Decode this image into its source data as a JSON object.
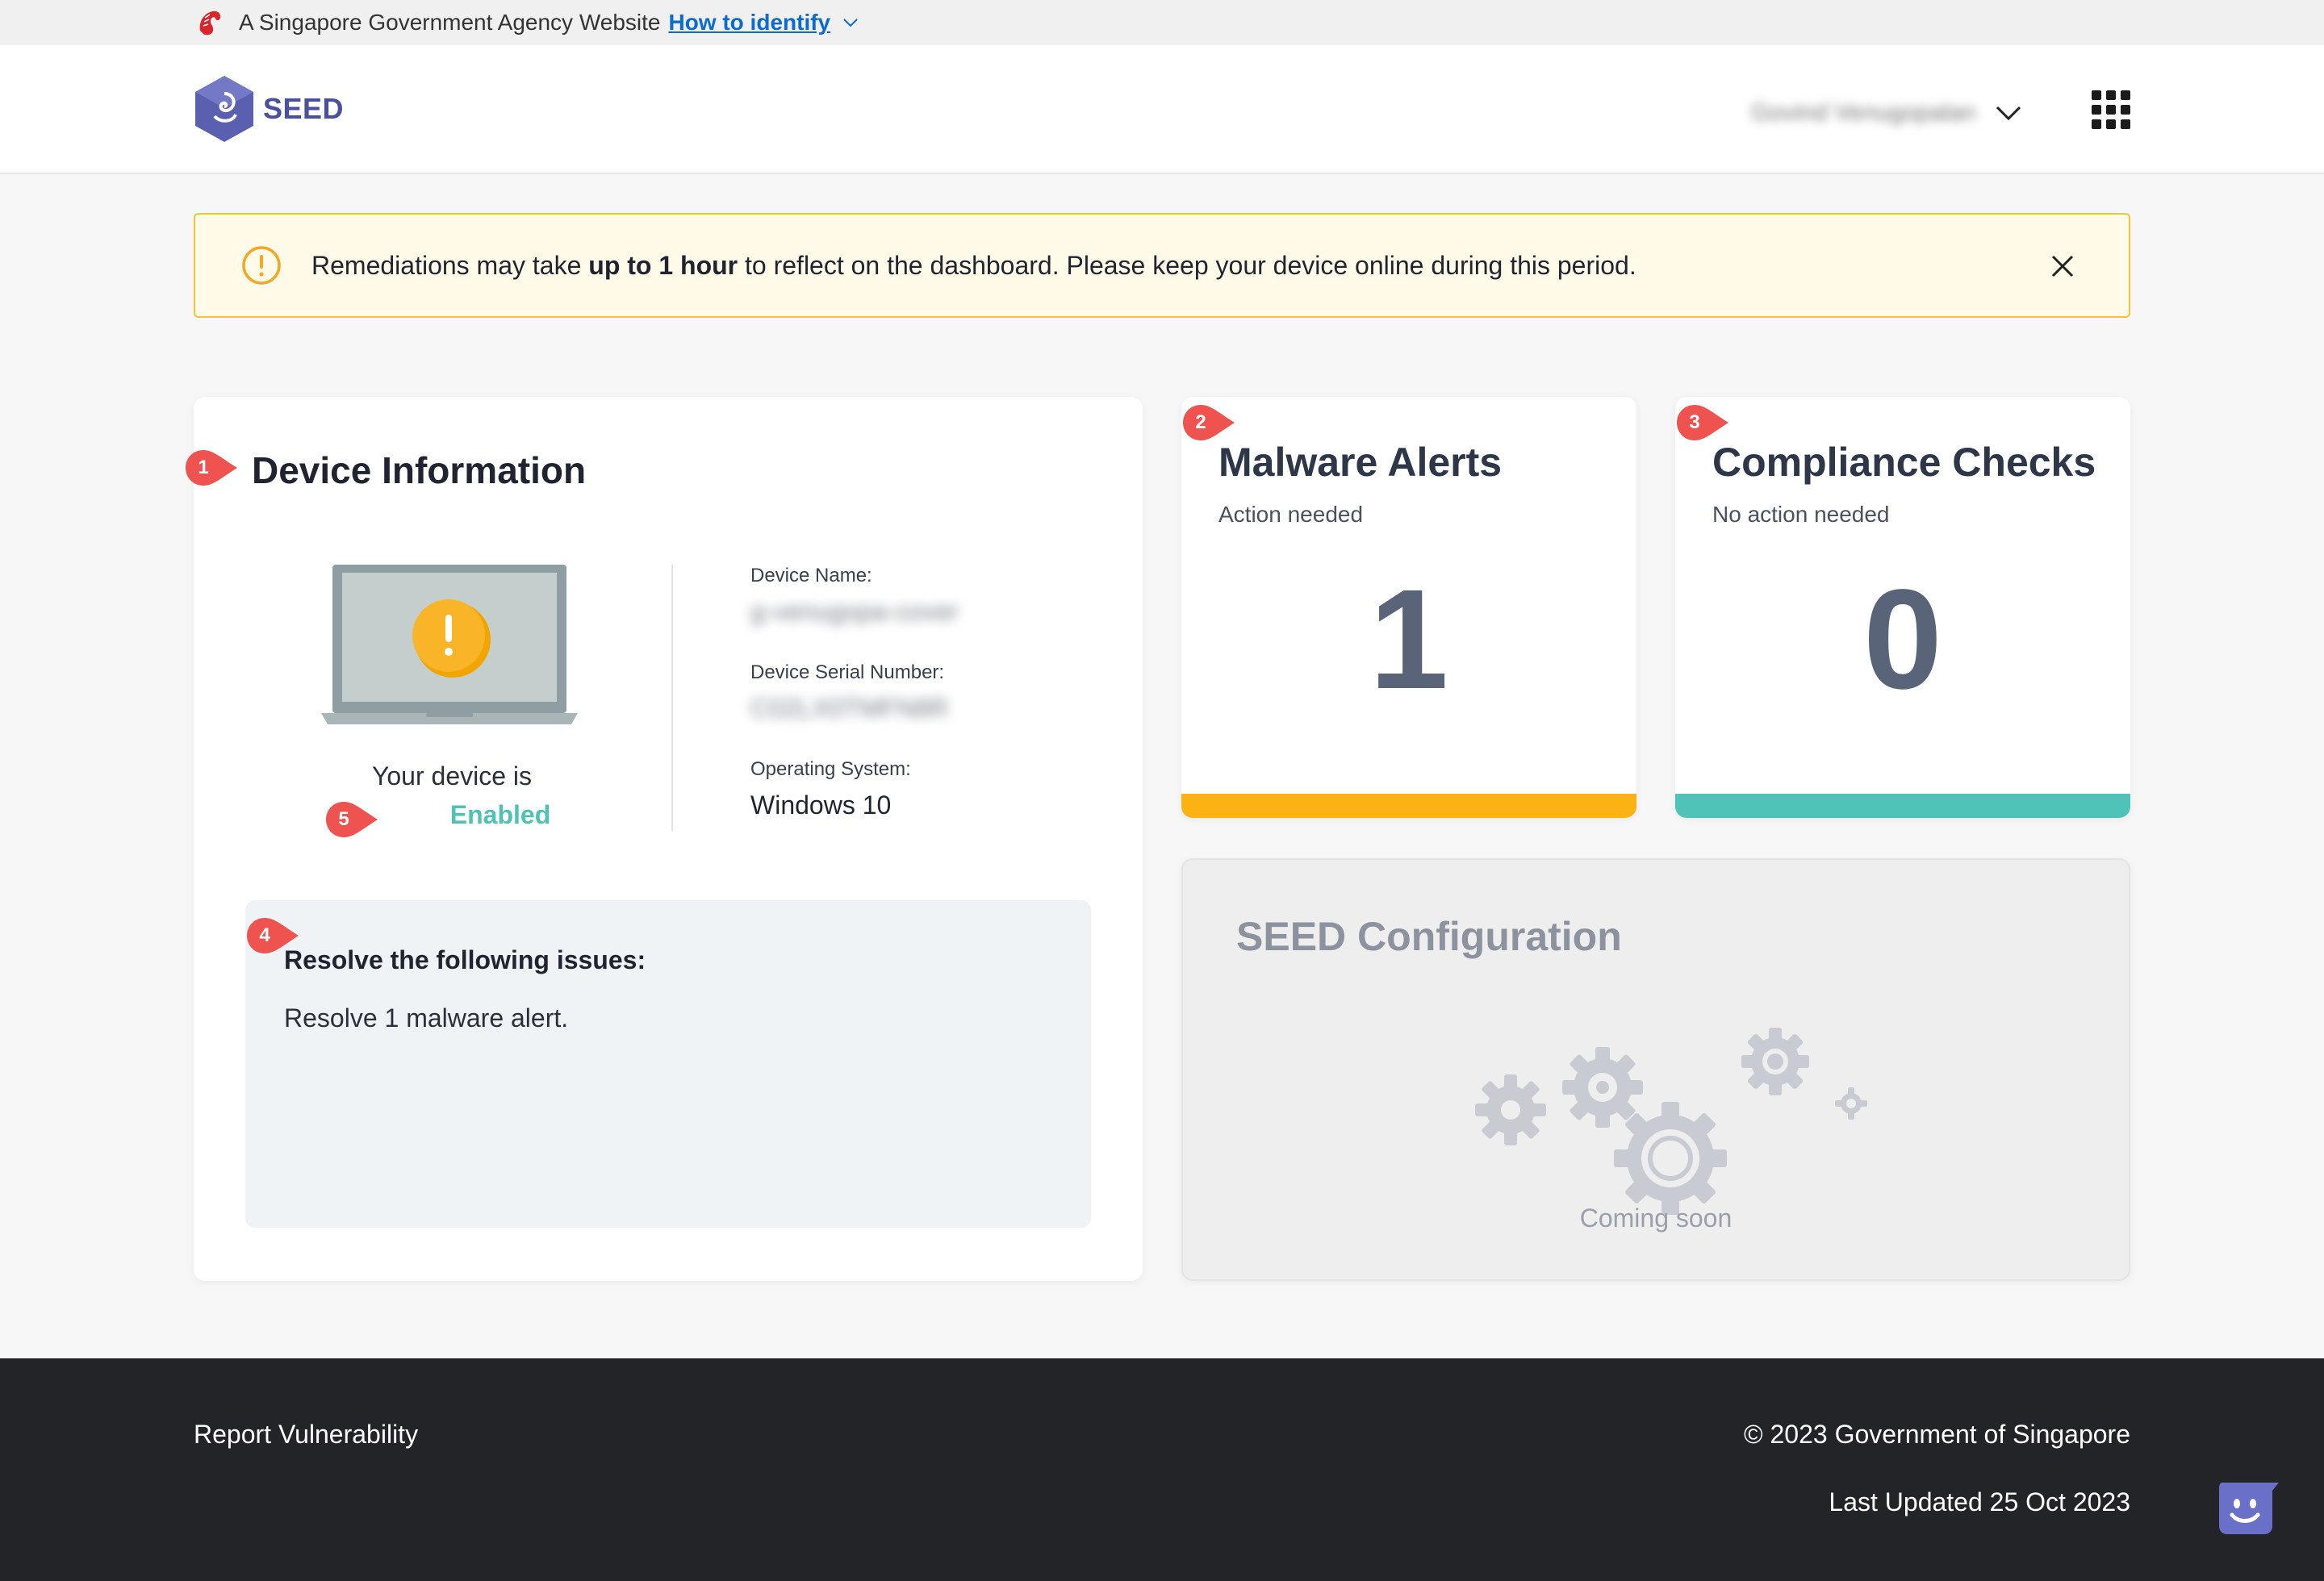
{
  "masthead": {
    "text": "A Singapore Government Agency Website",
    "link": "How to identify"
  },
  "header": {
    "logo_text": "SEED",
    "user_name": "Govind Venugopalan"
  },
  "notice": {
    "before": "Remediations may take ",
    "bold": "up to 1 hour",
    "after": " to reflect on the dashboard. Please keep your device online during this period."
  },
  "device": {
    "title": "Device Information",
    "status_label": "Your device is",
    "status_value": "Enabled",
    "device_name_label": "Device Name:",
    "device_name_value": "g-venugopa-cover",
    "serial_label": "Device Serial Number:",
    "serial_value": "C02LX0TMFN8R",
    "os_label": "Operating System:",
    "os_value": "Windows 10",
    "issues_heading": "Resolve the following issues:",
    "issues_text": "Resolve 1 malware alert."
  },
  "malware": {
    "title": "Malware Alerts",
    "subtitle": "Action needed",
    "count": "1",
    "color": "#fbb314"
  },
  "compliance": {
    "title": "Compliance Checks",
    "subtitle": "No action needed",
    "count": "0",
    "color": "#4fc3b8"
  },
  "config": {
    "title": "SEED Configuration",
    "status": "Coming soon"
  },
  "markers": [
    "1",
    "2",
    "3",
    "4",
    "5"
  ],
  "footer": {
    "report": "Report Vulnerability",
    "copyright": "© 2023 Government of Singapore",
    "updated": "Last Updated 25 Oct 2023"
  },
  "colors": {
    "accent": "#4a4fa0",
    "warning": "#f5a623",
    "marker": "#ef5350"
  }
}
